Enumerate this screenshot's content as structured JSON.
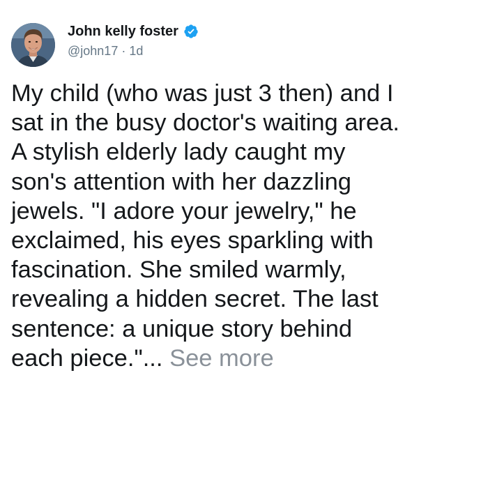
{
  "author": {
    "display_name": "John kelly foster",
    "handle": "@john17",
    "separator": "·",
    "age": "1d",
    "verified": true,
    "avatar_icon": "profile-photo"
  },
  "tweet": {
    "lines": [
      "My child (who was just 3 then) and I",
      "sat in the busy doctor's waiting area.",
      "A stylish elderly lady caught my",
      "son's attention with her dazzling",
      "jewels. \"I adore your jewelry,\" he",
      "exclaimed, his eyes sparkling with",
      "fascination. She smiled warmly,",
      "revealing a hidden secret. The last",
      "sentence: a unique story behind",
      "each piece.\"..."
    ],
    "see_more_label": "See more"
  },
  "colors": {
    "text": "#14171a",
    "secondary": "#657786",
    "verified_badge": "#1da1f2",
    "see_more": "#8a9199"
  }
}
